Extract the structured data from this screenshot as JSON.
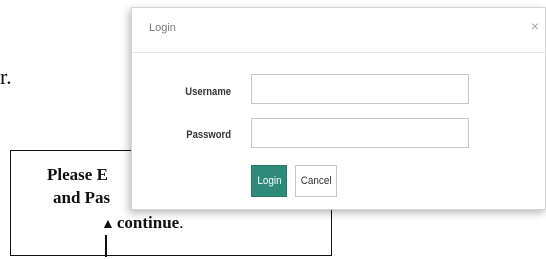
{
  "background": {
    "text_fragment": "r."
  },
  "callout": {
    "line1": "Please E",
    "line2": "and Pas",
    "line3_bold": "continue",
    "line3_suffix": ".",
    "arrow_glyph": "▲"
  },
  "dialog": {
    "title": "Login",
    "close_glyph": "×",
    "username_label": "Username",
    "username_value": "",
    "password_label": "Password",
    "password_value": "",
    "login_button": "Login",
    "cancel_button": "Cancel",
    "accent_color": "#2e8b7a"
  }
}
